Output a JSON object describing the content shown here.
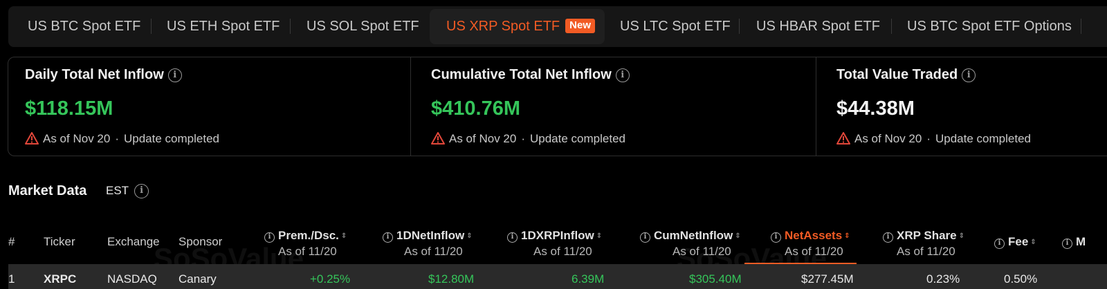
{
  "tabs": [
    {
      "label": "US BTC Spot ETF",
      "active": false
    },
    {
      "label": "US ETH Spot ETF",
      "active": false
    },
    {
      "label": "US SOL Spot ETF",
      "active": false
    },
    {
      "label": "US XRP Spot ETF",
      "active": true,
      "badge": "New"
    },
    {
      "label": "US LTC Spot ETF",
      "active": false
    },
    {
      "label": "US HBAR Spot ETF",
      "active": false
    },
    {
      "label": "US BTC Spot ETF Options",
      "active": false
    }
  ],
  "stats": [
    {
      "title": "Daily Total Net Inflow",
      "value": "$118.15M",
      "value_color": "#35c55a",
      "date": "As of Nov 20",
      "status": "Update completed"
    },
    {
      "title": "Cumulative Total Net Inflow",
      "value": "$410.76M",
      "value_color": "#35c55a",
      "date": "As of Nov 20",
      "status": "Update completed"
    },
    {
      "title": "Total Value Traded",
      "value": "$44.38M",
      "value_color": "#f4f4f4",
      "date": "As of Nov 20",
      "status": "Update completed"
    }
  ],
  "market": {
    "title": "Market Data",
    "timezone": "EST"
  },
  "table": {
    "columns": {
      "num": "#",
      "ticker": "Ticker",
      "exchange": "Exchange",
      "sponsor": "Sponsor",
      "prem": "Prem./Dsc.",
      "inflow": "1DNetInflow",
      "xrp_inflow": "1DXRPInflow",
      "cum": "CumNetInflow",
      "assets": "NetAssets",
      "share": "XRP Share",
      "fee": "Fee",
      "more": "M"
    },
    "as_of": "As of 11/20",
    "rows": [
      {
        "num": "1",
        "ticker": "XRPC",
        "exchange": "NASDAQ",
        "sponsor": "Canary",
        "prem": "+0.25%",
        "inflow": "$12.80M",
        "xrp_inflow": "6.39M",
        "cum": "$305.40M",
        "assets": "$277.45M",
        "share": "0.23%",
        "fee": "0.50%"
      }
    ]
  },
  "watermark": "SoSoValue",
  "colors": {
    "accent": "#f25b24",
    "positive": "#35c55a",
    "warning": "#e2473a"
  }
}
